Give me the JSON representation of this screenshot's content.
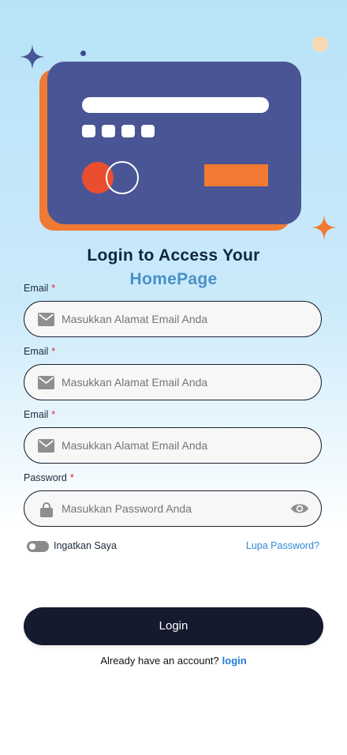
{
  "colors": {
    "card_front": "#4a5596",
    "card_back": "#f07a33",
    "accent_orange": "#f07a33",
    "title_dark": "#0f2540",
    "title_blue": "#4a8fc7",
    "button_bg": "#151a2f",
    "link_blue": "#1f7bd6",
    "required": "#d32f2f"
  },
  "header": {
    "title_line1": "Login to Access Your",
    "title_line2": "HomePage"
  },
  "form": {
    "fields": [
      {
        "label": "Email",
        "required_mark": "*",
        "placeholder": "Masukkan Alamat Email Anda",
        "icon": "envelope-icon"
      },
      {
        "label": "Email",
        "required_mark": "*",
        "placeholder": "Masukkan Alamat Email Anda",
        "icon": "envelope-icon"
      },
      {
        "label": "Email",
        "required_mark": "*",
        "placeholder": "Masukkan Alamat Email Anda",
        "icon": "envelope-icon"
      },
      {
        "label": "Password",
        "required_mark": "*",
        "placeholder": "Masukkan Password Anda",
        "icon": "lock-icon",
        "trailing_icon": "eye-icon"
      }
    ],
    "remember_me": "Ingatkan Saya",
    "remember_me_checked": false,
    "forgot_password": "Lupa Password?",
    "login_button": "Login"
  },
  "footer": {
    "prompt": "Already have an account?",
    "link": "login"
  }
}
